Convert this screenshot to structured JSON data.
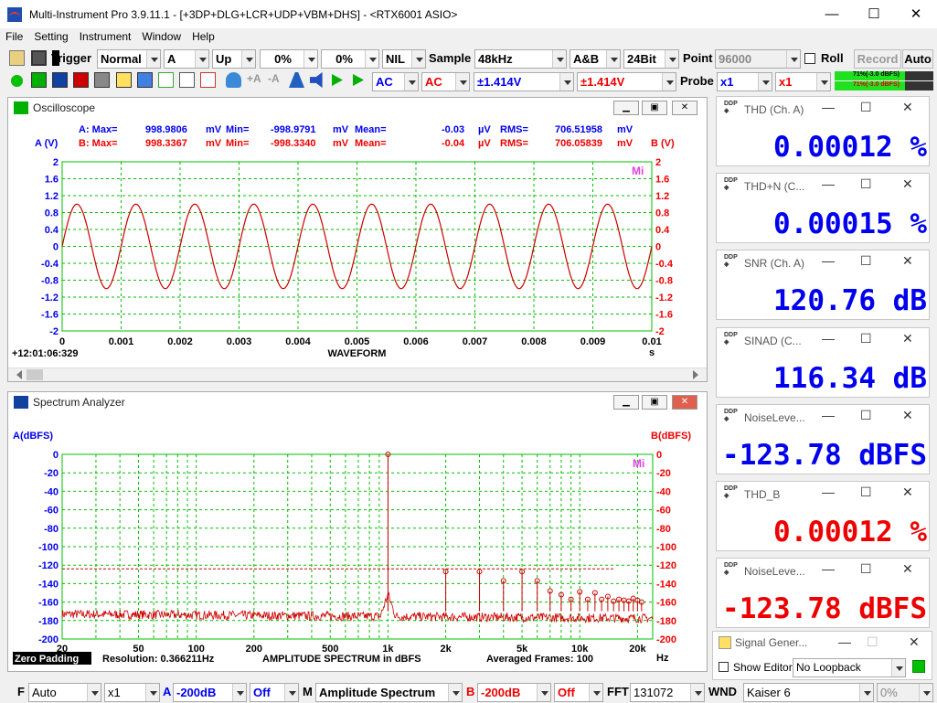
{
  "window": {
    "title": "Multi-Instrument Pro 3.9.11.1   -  [+3DP+DLG+LCR+UDP+VBM+DHS]   -  <RTX6001 ASIO>",
    "minimize": "—",
    "maximize": "☐",
    "close": "✕"
  },
  "menu": [
    "File",
    "Setting",
    "Instrument",
    "Window",
    "Help"
  ],
  "toolbar1": {
    "trigger_label": "Trigger",
    "trigger_mode": "Normal",
    "trigger_source": "A",
    "trigger_edge": "Up",
    "trigger_level1": "0%",
    "trigger_level2": "0%",
    "nil": "NIL",
    "sample_label": "Sample",
    "sample_rate": "48kHz",
    "channels": "A&B",
    "bits": "24Bit",
    "point_label": "Point",
    "point_value": "96000",
    "roll_label": "Roll",
    "record_label": "Record",
    "auto_label": "Auto"
  },
  "toolbar2": {
    "coupling_a": "AC",
    "coupling_b": "AC",
    "range_a": "±1.414V",
    "range_b": "±1.414V",
    "probe_label": "Probe",
    "probe_a": "x1",
    "probe_b": "x1",
    "level_a": "71%(-3.0 dBFS)",
    "level_b": "71%(-3.0 dBFS)",
    "level_a_pct": 0.71,
    "level_b_pct": 0.71
  },
  "oscilloscope": {
    "title": "Oscilloscope",
    "stats_a": {
      "label": "A: Max=",
      "max": "998.9806",
      "max_unit": "mV",
      "min_label": "Min=",
      "min": "-998.9791",
      "min_unit": "mV",
      "mean_label": "Mean=",
      "mean": "-0.03",
      "mean_unit": "µV",
      "rms_label": "RMS=",
      "rms": "706.51958",
      "rms_unit": "mV"
    },
    "stats_b": {
      "label": "B: Max=",
      "max": "998.3367",
      "max_unit": "mV",
      "min_label": "Min=",
      "min": "-998.3340",
      "min_unit": "mV",
      "mean_label": "Mean=",
      "mean": "-0.04",
      "mean_unit": "µV",
      "rms_label": "RMS=",
      "rms": "706.05839",
      "rms_unit": "mV"
    },
    "timestamp": "+12:01:06:329"
  },
  "spectrum": {
    "title": "Spectrum Analyzer",
    "zero_padding": "Zero Padding",
    "resolution": "Resolution: 0.366211Hz",
    "averaged": "Averaged Frames: 100"
  },
  "chart_data": [
    {
      "type": "line",
      "xlabel": "WAVEFORM",
      "ylabel": "A (V)",
      "ylabel_right": "B (V)",
      "x_unit": "s",
      "xlim": [
        0,
        0.01
      ],
      "ylim": [
        -2,
        2
      ],
      "x_ticks": [
        "0",
        "0.001",
        "0.002",
        "0.003",
        "0.004",
        "0.005",
        "0.006",
        "0.007",
        "0.008",
        "0.009",
        "0.01"
      ],
      "y_ticks": [
        "2",
        "1.6",
        "1.2",
        "0.8",
        "0.4",
        "0",
        "-0.4",
        "-0.8",
        "-1.2",
        "-1.6",
        "-2"
      ],
      "y_ticks_right": [
        "2",
        "1.6",
        "1.2",
        "0.8",
        "0.4",
        "0",
        "-0.4",
        "-0.8",
        "-1.2",
        "-1.6",
        "-2"
      ],
      "grid": true,
      "series": [
        {
          "frequency_hz": 1000,
          "amplitude_v": 0.999,
          "color": "#cc0000"
        }
      ]
    },
    {
      "type": "line",
      "xlabel": "AMPLITUDE SPECTRUM in dBFS",
      "ylabel": "A(dBFS)",
      "ylabel_right": "B(dBFS)",
      "x_unit": "Hz",
      "x_scale": "log",
      "xlim": [
        20,
        24000
      ],
      "ylim": [
        -200,
        0
      ],
      "x_ticks": [
        {
          "v": 20,
          "t": "20"
        },
        {
          "v": 50,
          "t": "50"
        },
        {
          "v": 100,
          "t": "100"
        },
        {
          "v": 200,
          "t": "200"
        },
        {
          "v": 500,
          "t": "500"
        },
        {
          "v": 1000,
          "t": "1k"
        },
        {
          "v": 2000,
          "t": "2k"
        },
        {
          "v": 5000,
          "t": "5k"
        },
        {
          "v": 10000,
          "t": "10k"
        },
        {
          "v": 20000,
          "t": "20k"
        }
      ],
      "y_ticks": [
        "0",
        "-20",
        "-40",
        "-60",
        "-80",
        "-100",
        "-120",
        "-140",
        "-160",
        "-180",
        "-200"
      ],
      "y_ticks_right": [
        "0",
        "-20",
        "-40",
        "-60",
        "-80",
        "-100",
        "-120",
        "-140",
        "-160",
        "-180",
        "-200"
      ],
      "grid": true,
      "noise_floor_db": -170,
      "threshold_db": -124,
      "peaks": [
        {
          "f": 1000,
          "db": 0
        },
        {
          "f": 2000,
          "db": -127
        },
        {
          "f": 3000,
          "db": -127
        },
        {
          "f": 4000,
          "db": -137
        },
        {
          "f": 5000,
          "db": -127
        },
        {
          "f": 6000,
          "db": -137
        },
        {
          "f": 7000,
          "db": -148
        },
        {
          "f": 8000,
          "db": -152
        },
        {
          "f": 9000,
          "db": -157
        },
        {
          "f": 10000,
          "db": -149
        },
        {
          "f": 11000,
          "db": -157
        },
        {
          "f": 12000,
          "db": -150
        },
        {
          "f": 13000,
          "db": -157
        },
        {
          "f": 14000,
          "db": -154
        },
        {
          "f": 15000,
          "db": -159
        },
        {
          "f": 16000,
          "db": -157
        },
        {
          "f": 17000,
          "db": -158
        },
        {
          "f": 18000,
          "db": -159
        },
        {
          "f": 19000,
          "db": -156
        },
        {
          "f": 20000,
          "db": -158
        },
        {
          "f": 21000,
          "db": -160
        }
      ]
    }
  ],
  "meters": [
    {
      "title": "THD (Ch. A)",
      "value": "0.00012 %",
      "color": "#0000ee"
    },
    {
      "title": "THD+N (C...",
      "value": "0.00015 %",
      "color": "#0000ee"
    },
    {
      "title": "SNR (Ch. A)",
      "value": "120.76 dB",
      "color": "#0000ee"
    },
    {
      "title": "SINAD (C...",
      "value": "116.34 dB",
      "color": "#0000ee"
    },
    {
      "title": "NoiseLeve...",
      "value": "-123.78 dBFS",
      "color": "#0000ee"
    },
    {
      "title": "THD_B",
      "value": "0.00012 %",
      "color": "#ee0000"
    },
    {
      "title": "NoiseLeve...",
      "value": "-123.78 dBFS",
      "color": "#ee0000"
    }
  ],
  "signal_generator": {
    "title": "Signal Gener...",
    "show_editor": "Show Editor",
    "loopback": "No Loopback"
  },
  "statusbar": {
    "f_label": "F",
    "f_value": "Auto",
    "zoom": "x1",
    "a_label": "A",
    "a_value": "-200dB",
    "a_off": "Off",
    "m_label": "M",
    "m_value": "Amplitude Spectrum",
    "b_label": "B",
    "b_value": "-200dB",
    "b_off": "Off",
    "fft_label": "FFT",
    "fft_value": "131072",
    "wnd_label": "WND",
    "wnd_value": "Kaiser 6",
    "pct": "0%"
  },
  "colors": {
    "a": "#0000ee",
    "b": "#ee0000",
    "grid": "#00c000",
    "trace": "#cc0000"
  }
}
